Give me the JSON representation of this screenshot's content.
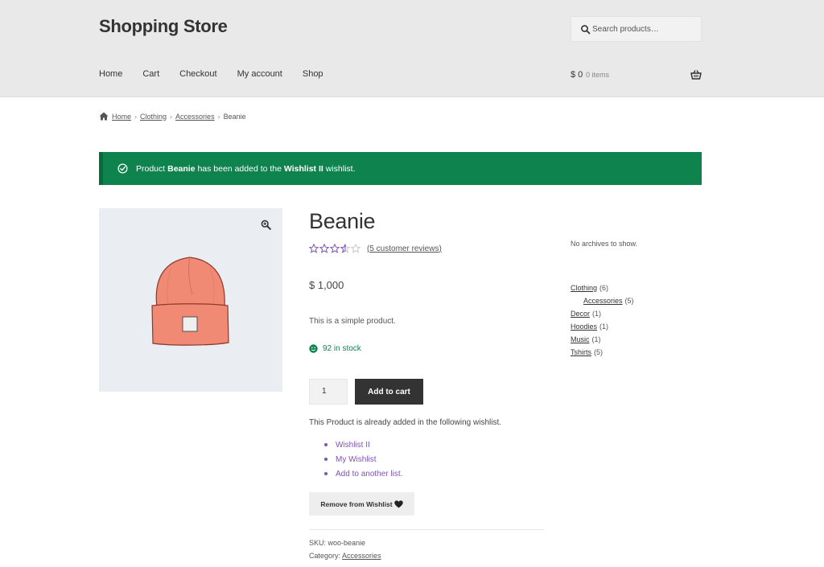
{
  "header": {
    "site_title": "Shopping Store",
    "search_placeholder": "Search products…",
    "nav": [
      "Home",
      "Cart",
      "Checkout",
      "My account",
      "Shop"
    ],
    "cart_amount": "$ 0",
    "cart_count": "0 items"
  },
  "breadcrumb": {
    "items": [
      "Home",
      "Clothing",
      "Accessories"
    ],
    "current": "Beanie",
    "separator": "›"
  },
  "notice": {
    "prefix": "Product ",
    "product": "Beanie",
    "middle": " has been added to the ",
    "wishlist": "Wishlist II",
    "suffix": " wishlist."
  },
  "product": {
    "title": "Beanie",
    "rating": 3.5,
    "reviews_label": "(5 customer reviews)",
    "price": "$ 1,000",
    "description": "This is a simple product.",
    "stock": "92 in stock",
    "quantity": "1",
    "add_to_cart_label": "Add to cart",
    "wishlist_text": "This Product is already added in the following wishlist.",
    "wishlists": [
      "Wishlist II",
      "My Wishlist",
      "Add to another list."
    ],
    "remove_label": "Remove from Wishlist",
    "sku": "SKU: woo-beanie",
    "category_label": "Category:",
    "category": "Accessories"
  },
  "sidebar": {
    "archives_empty": "No archives to show.",
    "categories": [
      {
        "name": "Clothing",
        "count": "(6)",
        "sub": false
      },
      {
        "name": "Accessories",
        "count": "(5)",
        "sub": true
      },
      {
        "name": "Decor",
        "count": "(1)",
        "sub": false
      },
      {
        "name": "Hoodies",
        "count": "(1)",
        "sub": false
      },
      {
        "name": "Music",
        "count": "(1)",
        "sub": false
      },
      {
        "name": "Tshirts",
        "count": "(5)",
        "sub": false
      }
    ]
  },
  "colors": {
    "header_bg": "#e9e9e9",
    "notice_bg": "#0f834d",
    "accent_purple": "#7f54b3",
    "button_dark": "#333333",
    "stock_green": "#0f834d",
    "beanie": "#f08a74"
  }
}
